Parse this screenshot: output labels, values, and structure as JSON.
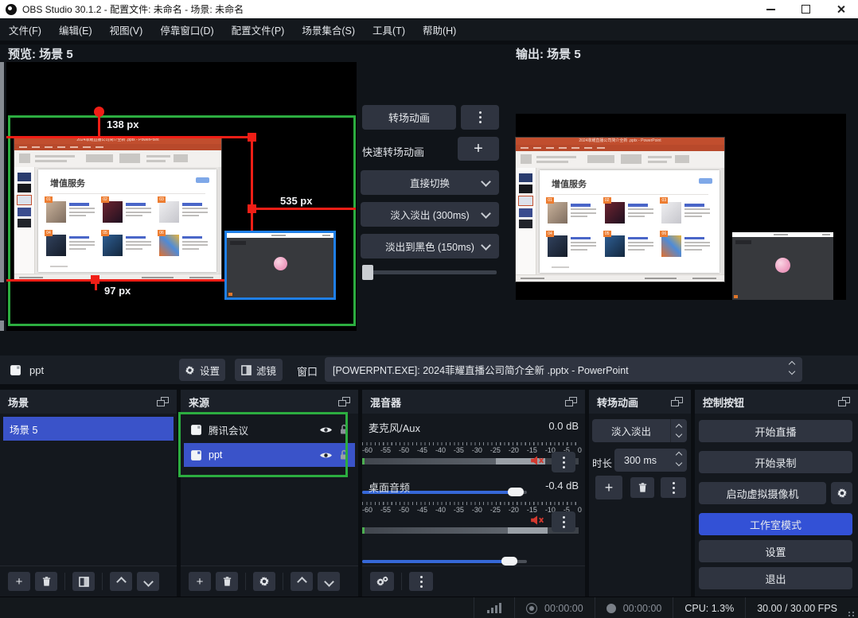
{
  "window": {
    "title": "OBS Studio 30.1.2 - 配置文件: 未命名 - 场景: 未命名"
  },
  "menu": {
    "items": [
      "文件(F)",
      "编辑(E)",
      "视图(V)",
      "停靠窗口(D)",
      "配置文件(P)",
      "场景集合(S)",
      "工具(T)",
      "帮助(H)"
    ]
  },
  "preview": {
    "label": "预览: 场景 5",
    "crop_top_label": "138 px",
    "crop_right_label": "535 px",
    "crop_bottom_label": "97 px"
  },
  "output_view": {
    "label": "输出: 场景 5"
  },
  "transition_overlay": {
    "transition_button": "转场动画",
    "quick_transition_label": "快速转场动画",
    "cut_transition": "直接切换",
    "quick_fade": "淡入淡出 (300ms)",
    "quick_fade_black": "淡出到黑色 (150ms)"
  },
  "ppt_window": {
    "title": "2024菲耀直播公司简介全新 .pptx - PowerPoint",
    "slide_title": "增值服务",
    "badges": [
      "01",
      "02",
      "03",
      "04",
      "05",
      "06"
    ]
  },
  "source_toolbar": {
    "source_name": "ppt",
    "settings_button": "设置",
    "filters_button": "滤镜",
    "window_label": "窗口",
    "window_value": "[POWERPNT.EXE]: 2024菲耀直播公司简介全新 .pptx - PowerPoint"
  },
  "scenes_panel": {
    "title": "场景",
    "items": [
      "场景 5"
    ]
  },
  "sources_panel": {
    "title": "来源",
    "items": [
      "腾讯会议",
      "ppt"
    ]
  },
  "mixer_panel": {
    "title": "混音器",
    "channel1": {
      "name": "麦克风/Aux",
      "level": "0.0 dB"
    },
    "channel2": {
      "name": "桌面音频",
      "level": "-0.4 dB"
    },
    "ticks": [
      "-60",
      "-55",
      "-50",
      "-45",
      "-40",
      "-35",
      "-30",
      "-25",
      "-20",
      "-15",
      "-10",
      "-5",
      "0"
    ]
  },
  "transitions_panel": {
    "title": "转场动画",
    "current_transition": "淡入淡出",
    "duration_label": "时长",
    "duration_value": "300 ms"
  },
  "controls_panel": {
    "title": "控制按钮",
    "start_streaming": "开始直播",
    "start_recording": "开始录制",
    "virtual_camera": "启动虚拟摄像机",
    "studio_mode": "工作室模式",
    "settings": "设置",
    "exit": "退出"
  },
  "status_bar": {
    "stream_time": "00:00:00",
    "record_time": "00:00:00",
    "cpu": "CPU: 1.3%",
    "fps": "30.00 / 30.00 FPS"
  },
  "colors": {
    "accent_blue": "#3A53C9",
    "studio_mode_blue": "#3351D6",
    "annotation_green": "#2CAD40",
    "crop_red": "#F01E16",
    "selection_blue": "#1F7FE6",
    "slider_blue": "#3668D8",
    "mute_red": "#D3392F"
  }
}
